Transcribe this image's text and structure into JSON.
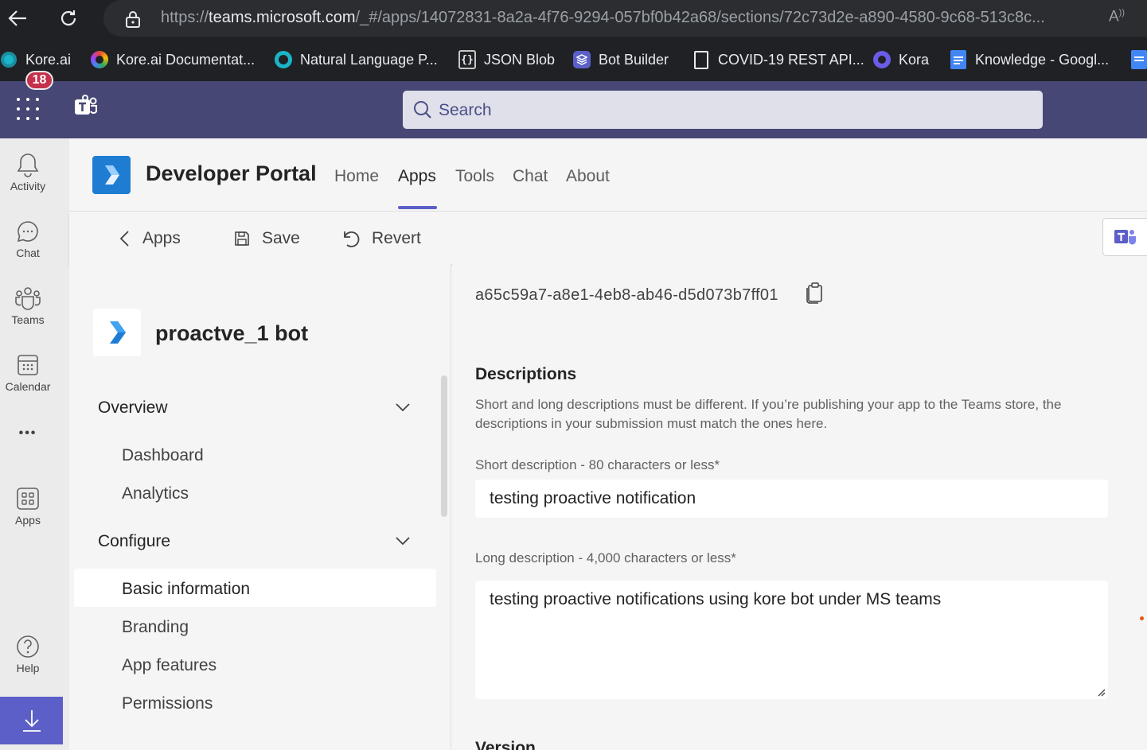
{
  "browser": {
    "url_prefix": "https://",
    "url_host": "teams.microsoft.com",
    "url_path": "/_#/apps/14072831-8a2a-4f76-9294-057bf0b42a68/sections/72c73d2e-a890-4580-9c68-513c8c...",
    "read_aloud": "Á"
  },
  "bookmarks": [
    {
      "label": "Kore.ai",
      "icon": "kore-icon"
    },
    {
      "label": "Kore.ai Documentat...",
      "icon": "kore-docs-icon"
    },
    {
      "label": "Natural Language P...",
      "icon": "nlp-icon"
    },
    {
      "label": "JSON Blob",
      "icon": "json-icon"
    },
    {
      "label": "Bot Builder",
      "icon": "bot-builder-icon"
    },
    {
      "label": "COVID-19 REST API...",
      "icon": "document-icon"
    },
    {
      "label": "Kora",
      "icon": "kora-icon"
    },
    {
      "label": "Knowledge - Googl...",
      "icon": "google-doc-icon"
    }
  ],
  "teams": {
    "search_placeholder": "Search"
  },
  "rail": {
    "activity": "Activity",
    "chat": "Chat",
    "chat_badge": "18",
    "teams": "Teams",
    "calendar": "Calendar",
    "more": "•••",
    "apps": "Apps",
    "help": "Help"
  },
  "app": {
    "title": "Developer Portal",
    "tabs": [
      "Home",
      "Apps",
      "Tools",
      "Chat",
      "About"
    ],
    "active_tab": "Apps"
  },
  "toolbar": {
    "back_label": "Apps",
    "save_label": "Save",
    "revert_label": "Revert"
  },
  "sidebar": {
    "bot_name": "proactve_1 bot",
    "overview": "Overview",
    "overview_items": [
      "Dashboard",
      "Analytics"
    ],
    "configure": "Configure",
    "configure_items": [
      "Basic information",
      "Branding",
      "App features",
      "Permissions"
    ],
    "active_item": "Basic information"
  },
  "form": {
    "app_id": "a65c59a7-a8e1-4eb8-ab46-d5d073b7ff01",
    "descriptions_heading": "Descriptions",
    "descriptions_help": "Short and long descriptions must be different. If you’re publishing your app to the Teams store, the descriptions in your submission must match the ones here.",
    "short_label": "Short description - 80 characters or less*",
    "short_value": "testing proactive notification",
    "long_label": "Long description - 4,000 characters or less*",
    "long_value": "testing proactive notifications using kore bot under MS teams",
    "version_heading": "Version"
  },
  "colors": {
    "teams_header": "#464775",
    "accent": "#5b5fc7",
    "badge": "#c4314b",
    "app_logo": "#1e7dd2"
  }
}
